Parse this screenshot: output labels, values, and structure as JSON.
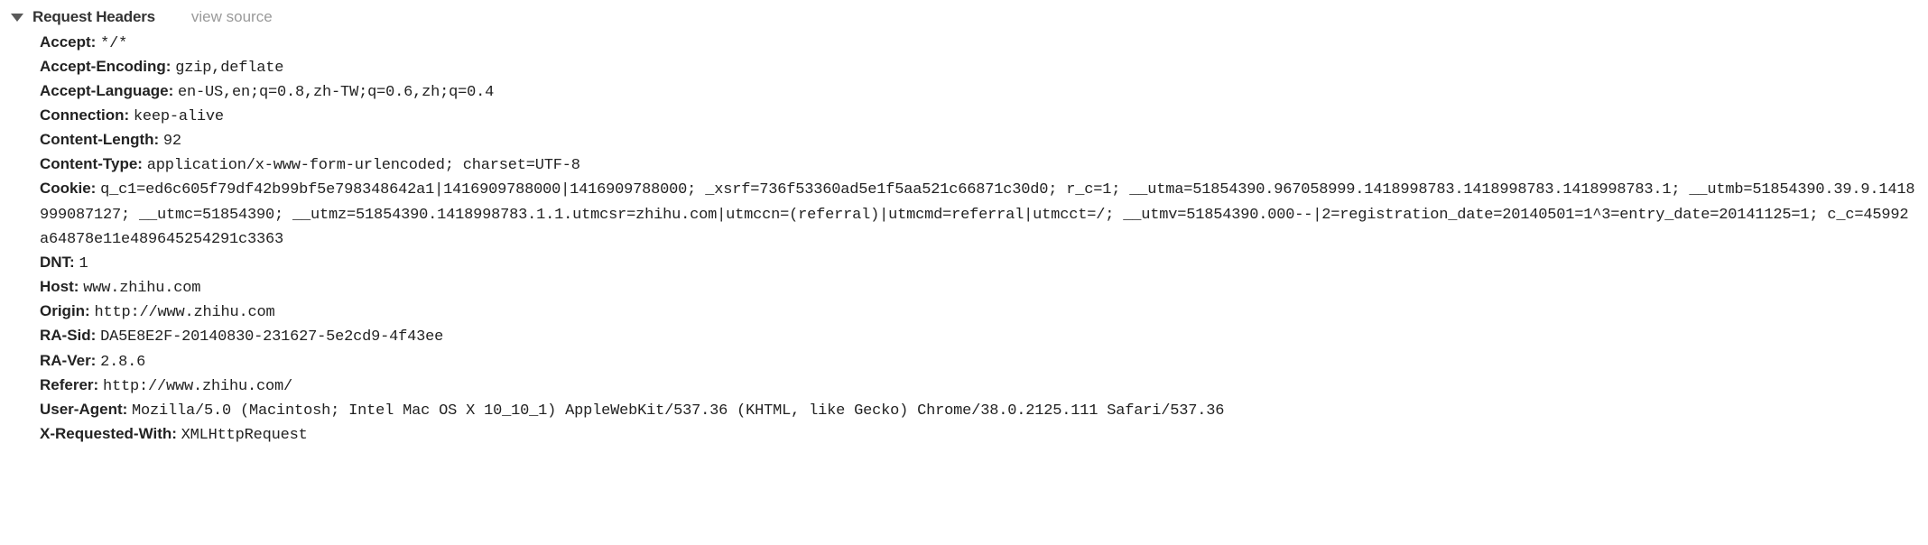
{
  "section": {
    "title": "Request Headers",
    "view_source_label": "view source"
  },
  "headers": [
    {
      "name": "Accept:",
      "value": "*/*"
    },
    {
      "name": "Accept-Encoding:",
      "value": "gzip,deflate"
    },
    {
      "name": "Accept-Language:",
      "value": "en-US,en;q=0.8,zh-TW;q=0.6,zh;q=0.4"
    },
    {
      "name": "Connection:",
      "value": "keep-alive"
    },
    {
      "name": "Content-Length:",
      "value": "92"
    },
    {
      "name": "Content-Type:",
      "value": "application/x-www-form-urlencoded; charset=UTF-8"
    },
    {
      "name": "Cookie:",
      "value": "q_c1=ed6c605f79df42b99bf5e798348642a1|1416909788000|1416909788000; _xsrf=736f53360ad5e1f5aa521c66871c30d0; r_c=1; __utma=51854390.967058999.1418998783.1418998783.1418998783.1; __utmb=51854390.39.9.1418999087127; __utmc=51854390; __utmz=51854390.1418998783.1.1.utmcsr=zhihu.com|utmccn=(referral)|utmcmd=referral|utmcct=/; __utmv=51854390.000--|2=registration_date=20140501=1^3=entry_date=20141125=1; c_c=45992a64878e11e489645254291c3363"
    },
    {
      "name": "DNT:",
      "value": "1"
    },
    {
      "name": "Host:",
      "value": "www.zhihu.com"
    },
    {
      "name": "Origin:",
      "value": "http://www.zhihu.com"
    },
    {
      "name": "RA-Sid:",
      "value": "DA5E8E2F-20140830-231627-5e2cd9-4f43ee"
    },
    {
      "name": "RA-Ver:",
      "value": "2.8.6"
    },
    {
      "name": "Referer:",
      "value": "http://www.zhihu.com/"
    },
    {
      "name": "User-Agent:",
      "value": "Mozilla/5.0 (Macintosh; Intel Mac OS X 10_10_1) AppleWebKit/537.36 (KHTML, like Gecko) Chrome/38.0.2125.111 Safari/537.36"
    },
    {
      "name": "X-Requested-With:",
      "value": "XMLHttpRequest"
    }
  ]
}
